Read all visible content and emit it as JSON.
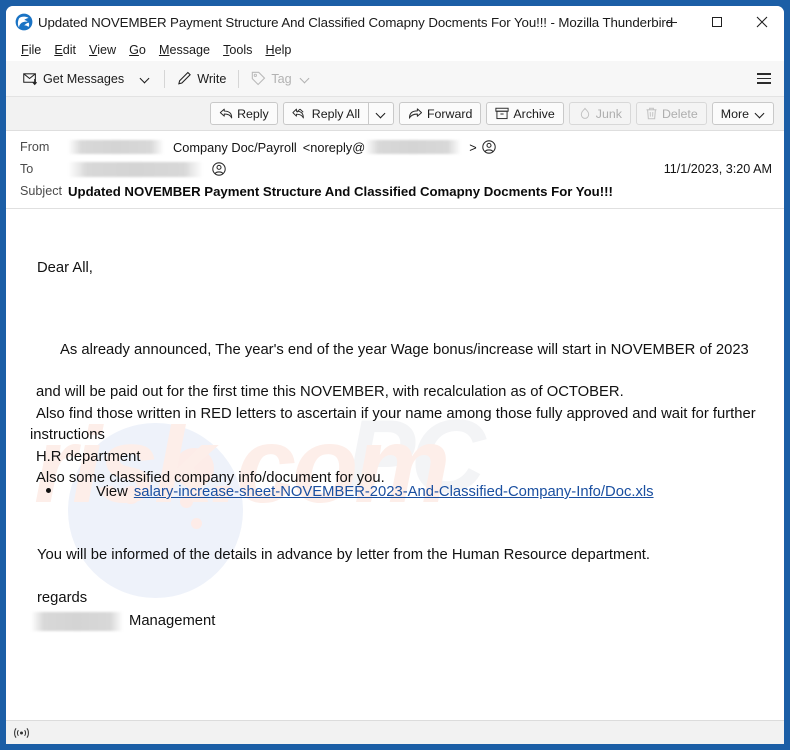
{
  "window": {
    "title": "Updated NOVEMBER Payment Structure And Classified Comapny Docments For You!!! - Mozilla Thunderbird",
    "app_icon": "thunderbird-icon",
    "controls": {
      "minimize": "minimize-icon",
      "maximize": "maximize-icon",
      "close": "close-icon"
    }
  },
  "menubar": {
    "items": [
      {
        "label": "File",
        "accesskey": "F"
      },
      {
        "label": "Edit",
        "accesskey": "E"
      },
      {
        "label": "View",
        "accesskey": "V"
      },
      {
        "label": "Go",
        "accesskey": "G"
      },
      {
        "label": "Message",
        "accesskey": "M"
      },
      {
        "label": "Tools",
        "accesskey": "T"
      },
      {
        "label": "Help",
        "accesskey": "H"
      }
    ]
  },
  "toolbar": {
    "get_messages": "Get Messages",
    "write": "Write",
    "tag": "Tag",
    "app_menu": "app-menu-icon"
  },
  "message_toolbar": {
    "reply": "Reply",
    "reply_all": "Reply All",
    "forward": "Forward",
    "archive": "Archive",
    "junk": "Junk",
    "delete": "Delete",
    "more": "More"
  },
  "headers": {
    "from_label": "From",
    "from_name": "Company Doc/Payroll",
    "from_address_prefix": "<noreply@",
    "from_address_suffix": ">",
    "to_label": "To",
    "date": "11/1/2023, 3:20 AM",
    "subject_label": "Subject",
    "subject": "Updated NOVEMBER Payment Structure And Classified Comapny Docments For You!!!"
  },
  "body": {
    "greeting": "Dear All,",
    "paragraph1": "As already announced, The year's end of the year Wage bonus/increase will start in NOVEMBER of 2023",
    "line2": "and will be paid out for the first time this NOVEMBER, with recalculation as of OCTOBER.",
    "line3": "Also find those written in RED letters to ascertain if your name among those fully approved and wait for further instructions",
    "line4": "H.R department",
    "line5": "Also  some classified company info/document for you.",
    "bullet_prefix": "View",
    "attachment_link": "salary-increase-sheet-NOVEMBER-2023-And-Classified-Company-Info/Doc.xls",
    "closing": "You will be informed of the details in advance by letter from the Human Resource department.",
    "regards": "regards",
    "signature": "Management",
    "watermark_left": "risk.com",
    "watermark_right": "PC"
  },
  "statusbar": {
    "connection_icon": "online-status-icon"
  },
  "colors": {
    "window_border": "#1b5ea6",
    "link": "#1a4fa0",
    "toolbar_bg": "#f2f2f2",
    "body_bg": "#ffffff"
  }
}
